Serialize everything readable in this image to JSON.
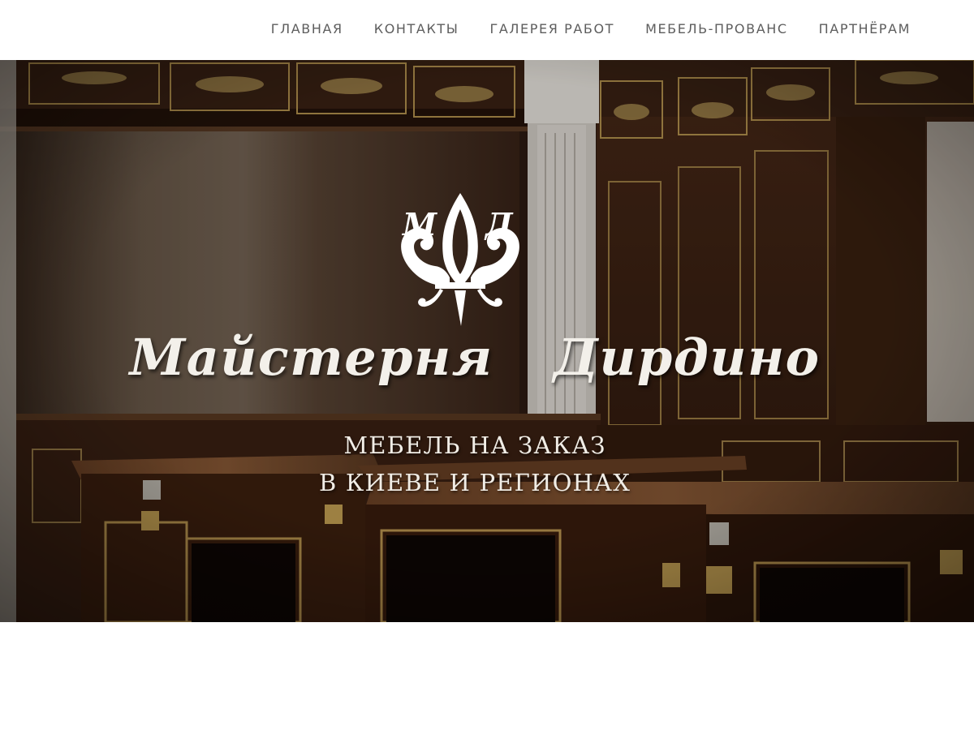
{
  "nav": {
    "items": [
      {
        "label": "ГЛАВНАЯ"
      },
      {
        "label": "КОНТАКТЫ"
      },
      {
        "label": "ГАЛЕРЕЯ РАБОТ"
      },
      {
        "label": "МЕБЕЛЬ-ПРОВАНС"
      },
      {
        "label": "ПАРТНЁРАМ"
      }
    ]
  },
  "hero": {
    "logo": {
      "icon": "fleur-de-lis-icon",
      "monogram_left": "М",
      "monogram_right": "Д"
    },
    "title": "Майстерня  Дирдино",
    "tagline_line1": "МЕБЕЛЬ НА ЗАКАЗ",
    "tagline_line2": "В КИЕВЕ И РЕГИОНАХ",
    "background": "wooden-office-interior-image"
  },
  "colors": {
    "nav_text": "#5d5d5d",
    "hero_text": "#f3f0ea",
    "wood_dark": "#2a1a10",
    "gold_trim": "#b8954f"
  }
}
